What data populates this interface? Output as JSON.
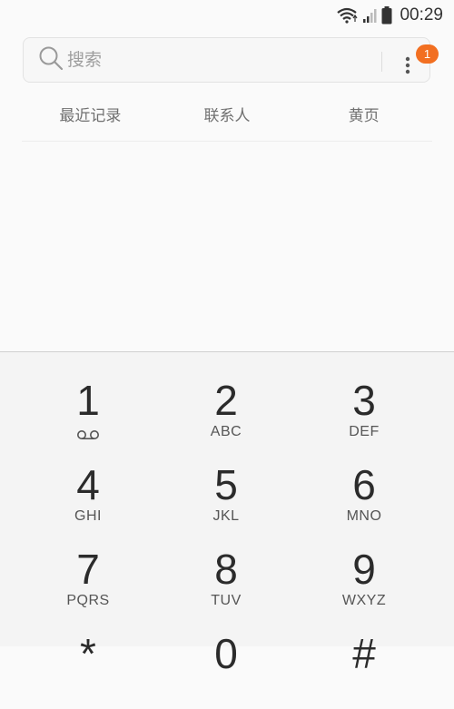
{
  "status_bar": {
    "time": "00:29",
    "icons": [
      "wifi-icon",
      "signal-icon",
      "battery-icon"
    ]
  },
  "search": {
    "placeholder": "搜索",
    "icon": "search-icon",
    "badge_count": "1"
  },
  "tabs": [
    {
      "label": "最近记录"
    },
    {
      "label": "联系人"
    },
    {
      "label": "黄页"
    }
  ],
  "keypad": {
    "keys": [
      {
        "digit": "1",
        "letters": "",
        "icon": "voicemail-icon"
      },
      {
        "digit": "2",
        "letters": "ABC"
      },
      {
        "digit": "3",
        "letters": "DEF"
      },
      {
        "digit": "4",
        "letters": "GHI"
      },
      {
        "digit": "5",
        "letters": "JKL"
      },
      {
        "digit": "6",
        "letters": "MNO"
      },
      {
        "digit": "7",
        "letters": "PQRS"
      },
      {
        "digit": "8",
        "letters": "TUV"
      },
      {
        "digit": "9",
        "letters": "WXYZ"
      },
      {
        "digit": "*",
        "letters": ""
      },
      {
        "digit": "0",
        "letters": ""
      },
      {
        "digit": "#",
        "letters": ""
      }
    ]
  },
  "colors": {
    "badge": "#f26f21",
    "background": "#fafafa",
    "keypad_background": "#f4f4f4"
  }
}
